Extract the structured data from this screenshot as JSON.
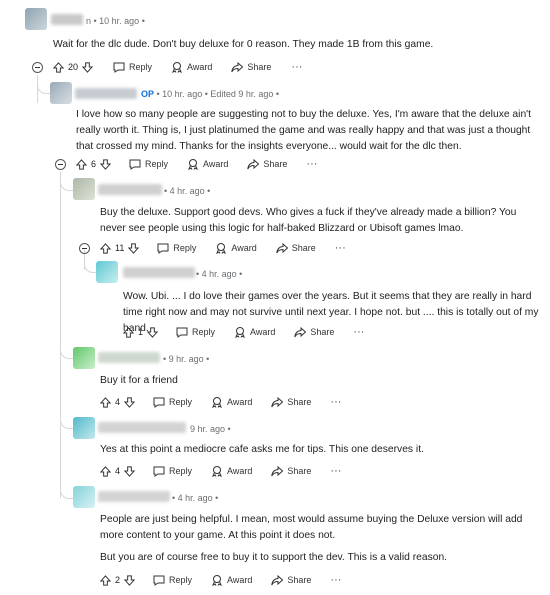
{
  "comments": [
    {
      "meta": "n • 10 hr. ago •",
      "text": "Wait for the dlc dude. Don't buy deluxe for 0 reason. They made 1B from this game.",
      "score": "20",
      "actions": {
        "reply": "Reply",
        "award": "Award",
        "share": "Share",
        "more": "···"
      }
    },
    {
      "author_tag": "OP",
      "meta": " • 10 hr. ago • Edited 9 hr. ago •",
      "text": "I love how so many people are suggesting not to buy the deluxe. Yes, I'm aware that the deluxe ain't really worth it. Thing is, I just platinumed the game and was really happy and that was just a thought that crossed my mind. Thanks for the insights everyone... would wait for the dlc then.",
      "score": "6",
      "actions": {
        "reply": "Reply",
        "award": "Award",
        "share": "Share",
        "more": "···"
      }
    },
    {
      "meta": "• 4 hr. ago •",
      "text": "Buy the deluxe. Support good devs. Who gives a fuck if they've already made a billion? You never see people using this logic for half-baked Blizzard or Ubisoft games lmao.",
      "score": "11",
      "actions": {
        "reply": "Reply",
        "award": "Award",
        "share": "Share",
        "more": "···"
      }
    },
    {
      "meta": "• 4 hr. ago •",
      "text": "Wow. Ubi. ... I do love their games over the years. But it seems that they are really in hard time right now and may not survive until next year. I hope not. but .... this is totally out of my hand.",
      "score": "1",
      "actions": {
        "reply": "Reply",
        "award": "Award",
        "share": "Share",
        "more": "···"
      }
    },
    {
      "meta": "• 9 hr. ago •",
      "text": "Buy it for a friend",
      "score": "4",
      "actions": {
        "reply": "Reply",
        "award": "Award",
        "share": "Share",
        "more": "···"
      }
    },
    {
      "meta": "9 hr. ago •",
      "text": "Yes at this point a mediocre cafe asks me for tips. This one deserves it.",
      "score": "4",
      "actions": {
        "reply": "Reply",
        "award": "Award",
        "share": "Share",
        "more": "···"
      }
    },
    {
      "meta": "• 4 hr. ago •",
      "text_p1": "People are just being helpful. I mean, most would assume buying the Deluxe version will add more content to your game. At this point it does not.",
      "text_p2": "But you are of course free to buy it to support the dev. This is a valid reason.",
      "score": "2",
      "actions": {
        "reply": "Reply",
        "award": "Award",
        "share": "Share",
        "more": "···"
      }
    }
  ]
}
